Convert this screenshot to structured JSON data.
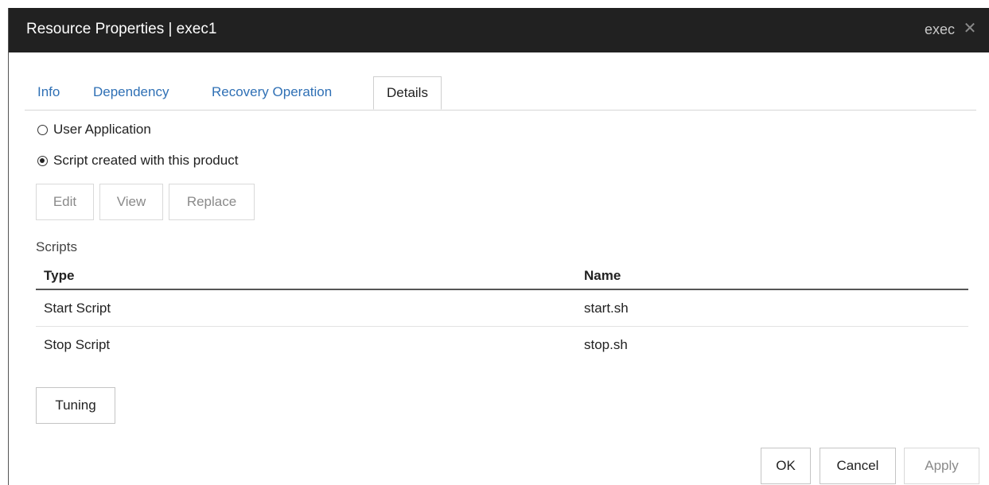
{
  "window": {
    "title": "Resource Properties | exec1",
    "resource_type": "exec",
    "close_icon": "close-icon"
  },
  "tabs": [
    {
      "label": "Info",
      "active": false
    },
    {
      "label": "Dependency",
      "active": false
    },
    {
      "label": "Recovery Operation",
      "active": false
    },
    {
      "label": "Details",
      "active": true
    }
  ],
  "options": {
    "user_application": {
      "label": "User Application",
      "checked": false
    },
    "script_created": {
      "label": "Script created with this product",
      "checked": true
    }
  },
  "script_buttons": {
    "edit": "Edit",
    "view": "View",
    "replace": "Replace"
  },
  "scripts": {
    "label": "Scripts",
    "columns": [
      "Type",
      "Name"
    ],
    "rows": [
      [
        "Start Script",
        "start.sh"
      ],
      [
        "Stop Script",
        "stop.sh"
      ]
    ]
  },
  "tuning_button": "Tuning",
  "footer": {
    "ok": "OK",
    "cancel": "Cancel",
    "apply": "Apply"
  }
}
